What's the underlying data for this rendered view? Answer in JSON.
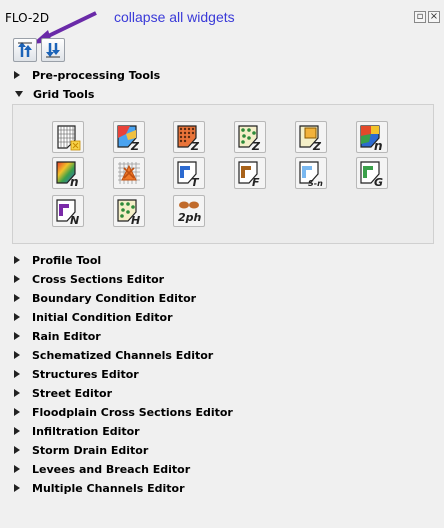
{
  "panel": {
    "title": "FLO-2D"
  },
  "annotation": {
    "text": "collapse all widgets",
    "color": "#3a3ad8"
  },
  "toolbar": [
    {
      "name": "collapse-all-widgets-icon"
    },
    {
      "name": "expand-all-widgets-icon"
    }
  ],
  "sections": {
    "preprocessing": "Pre-processing Tools",
    "grid_tools": "Grid Tools",
    "items": [
      "Profile Tool",
      "Cross Sections Editor",
      "Boundary Condition Editor",
      "Initial Condition Editor",
      "Rain Editor",
      "Schematized Channels Editor",
      "Structures Editor",
      "Street Editor",
      "Floodplain Cross Sections Editor",
      "Infiltration Editor",
      "Storm Drain Editor",
      "Levees and Breach Editor",
      "Multiple Channels Editor"
    ]
  },
  "grid_tool_icons": {
    "letters": {
      "z": "Z",
      "n": "n",
      "t": "T",
      "f": "F",
      "sn": "S-n",
      "g": "G",
      "N": "N",
      "h": "H",
      "twoph": "2ph"
    }
  }
}
